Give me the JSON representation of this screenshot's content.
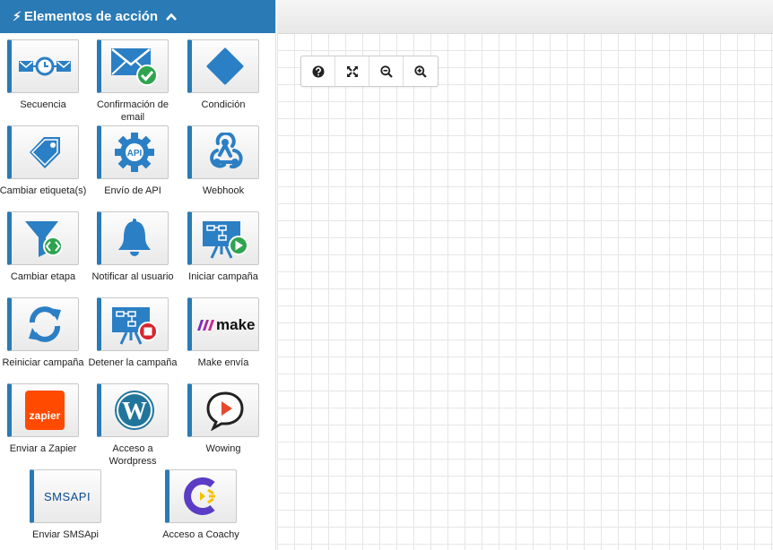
{
  "sidebar": {
    "title": "Elementos de acción",
    "items": [
      {
        "label": "Secuencia",
        "icon": "sequence-icon"
      },
      {
        "label": "Confirmación de email",
        "icon": "email-confirmation-icon"
      },
      {
        "label": "Condición",
        "icon": "condition-diamond-icon"
      },
      {
        "label": "Cambiar etiqueta(s)",
        "icon": "tag-icon"
      },
      {
        "label": "Envío de API",
        "icon": "api-gear-icon"
      },
      {
        "label": "Webhook",
        "icon": "webhook-icon"
      },
      {
        "label": "Cambiar etapa",
        "icon": "funnel-icon"
      },
      {
        "label": "Notificar al usuario",
        "icon": "bell-icon"
      },
      {
        "label": "Iniciar campaña",
        "icon": "start-campaign-icon"
      },
      {
        "label": "Reiniciar campaña",
        "icon": "restart-icon"
      },
      {
        "label": "Detener la campaña",
        "icon": "stop-campaign-icon"
      },
      {
        "label": "Make envía",
        "icon": "make-logo"
      },
      {
        "label": "Enviar a Zapier",
        "icon": "zapier-logo"
      },
      {
        "label": "Acceso a Wordpress",
        "icon": "wordpress-logo"
      },
      {
        "label": "Wowing",
        "icon": "wowing-logo"
      },
      {
        "label": "Enviar SMSApi",
        "icon": "smsapi-logo"
      },
      {
        "label": "Acceso a Coachy",
        "icon": "coachy-logo"
      }
    ]
  },
  "logos": {
    "make": "make",
    "zapier": "zapier",
    "smsapi": "SMSAPI",
    "api": "API"
  },
  "toolbar": [
    "help-icon",
    "fit-screen-icon",
    "zoom-out-icon",
    "zoom-in-icon"
  ],
  "colors": {
    "primary": "#2a7ab5",
    "icon_blue": "#2b7fc4",
    "green": "#2ea44f",
    "red": "#d9252b",
    "zapier": "#ff4a00",
    "coachy": "#5b3cc4",
    "coachy_accent": "#f5c000"
  }
}
